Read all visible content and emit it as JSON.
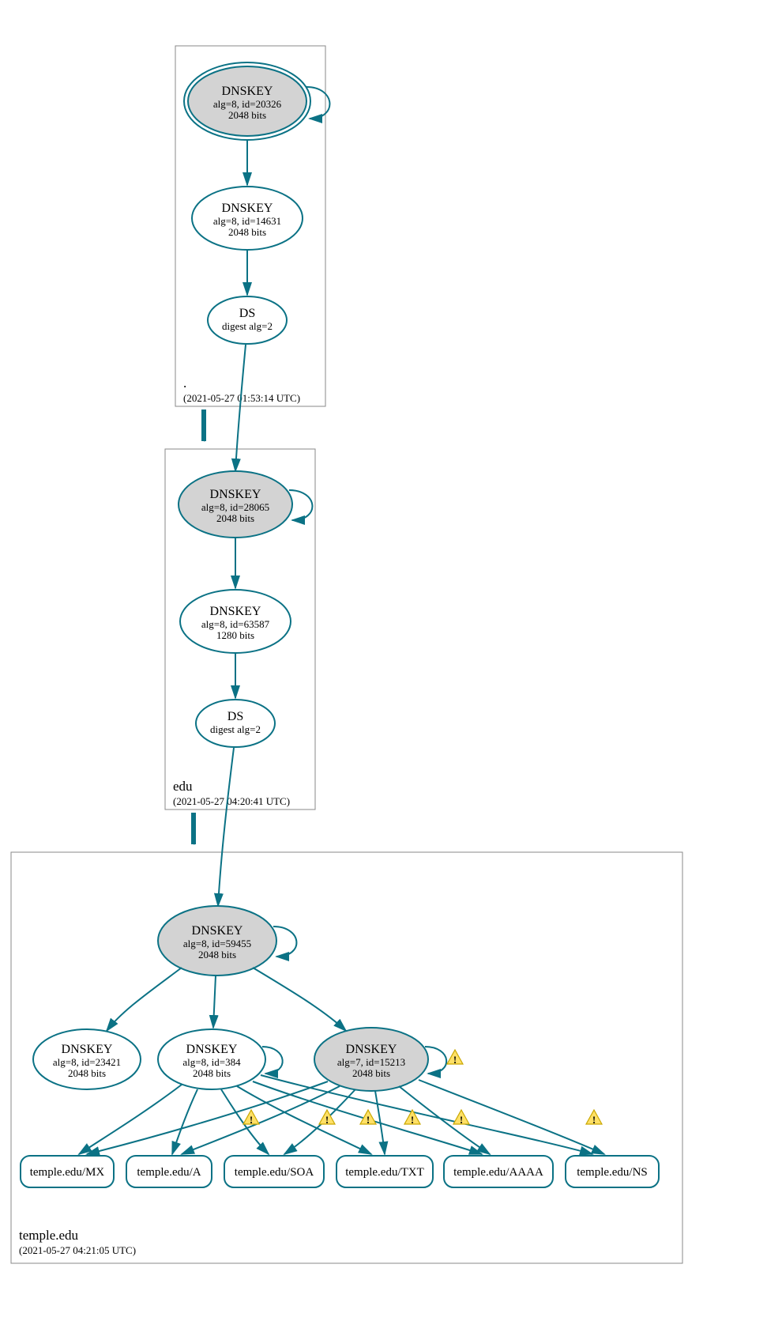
{
  "zones": {
    "root": {
      "label": ".",
      "timestamp": "(2021-05-27 01:53:14 UTC)",
      "nodes": {
        "ksk": {
          "title": "DNSKEY",
          "line2": "alg=8, id=20326",
          "line3": "2048 bits"
        },
        "zsk": {
          "title": "DNSKEY",
          "line2": "alg=8, id=14631",
          "line3": "2048 bits"
        },
        "ds": {
          "title": "DS",
          "line2": "digest alg=2"
        }
      }
    },
    "edu": {
      "label": "edu",
      "timestamp": "(2021-05-27 04:20:41 UTC)",
      "nodes": {
        "ksk": {
          "title": "DNSKEY",
          "line2": "alg=8, id=28065",
          "line3": "2048 bits"
        },
        "zsk": {
          "title": "DNSKEY",
          "line2": "alg=8, id=63587",
          "line3": "1280 bits"
        },
        "ds": {
          "title": "DS",
          "line2": "digest alg=2"
        }
      }
    },
    "temple": {
      "label": "temple.edu",
      "timestamp": "(2021-05-27 04:21:05 UTC)",
      "nodes": {
        "ksk": {
          "title": "DNSKEY",
          "line2": "alg=8, id=59455",
          "line3": "2048 bits"
        },
        "k1": {
          "title": "DNSKEY",
          "line2": "alg=8, id=23421",
          "line3": "2048 bits"
        },
        "k2": {
          "title": "DNSKEY",
          "line2": "alg=8, id=384",
          "line3": "2048 bits"
        },
        "k3": {
          "title": "DNSKEY",
          "line2": "alg=7, id=15213",
          "line3": "2048 bits"
        }
      },
      "rrsets": {
        "mx": "temple.edu/MX",
        "a": "temple.edu/A",
        "soa": "temple.edu/SOA",
        "txt": "temple.edu/TXT",
        "aaaa": "temple.edu/AAAA",
        "ns": "temple.edu/NS"
      }
    }
  }
}
